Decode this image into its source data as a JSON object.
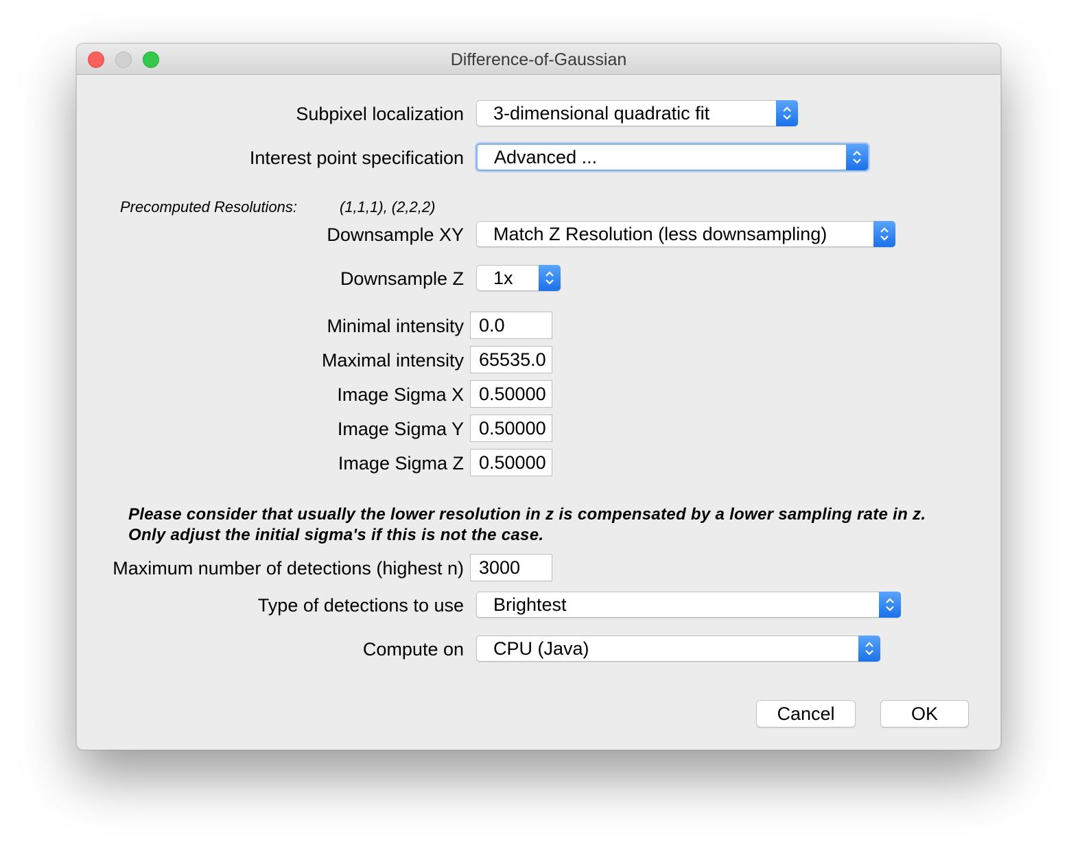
{
  "window": {
    "title": "Difference-of-Gaussian"
  },
  "subpixel": {
    "label": "Subpixel localization",
    "value": "3-dimensional quadratic fit"
  },
  "interest_point": {
    "label": "Interest point specification",
    "value": "Advanced ..."
  },
  "precomputed": {
    "label": "Precomputed Resolutions:",
    "value": "(1,1,1), (2,2,2)"
  },
  "downsample_xy": {
    "label": "Downsample XY",
    "value": "Match Z Resolution (less downsampling)"
  },
  "downsample_z": {
    "label": "Downsample Z",
    "value": "1x"
  },
  "fields": {
    "min_intensity": {
      "label": "Minimal intensity",
      "value": "0.0"
    },
    "max_intensity": {
      "label": "Maximal intensity",
      "value": "65535.0"
    },
    "sigma_x": {
      "label": "Image Sigma X",
      "value": "0.50000"
    },
    "sigma_y": {
      "label": "Image Sigma Y",
      "value": "0.50000"
    },
    "sigma_z": {
      "label": "Image Sigma Z",
      "value": "0.50000"
    }
  },
  "note": {
    "line1": "Please consider that usually the lower resolution in z is compensated by a lower sampling rate in z.",
    "line2": "Only adjust the initial sigma's if this is not the case."
  },
  "max_detections": {
    "label": "Maximum number of detections (highest n)",
    "value": "3000"
  },
  "detection_type": {
    "label": "Type of detections to use",
    "value": "Brightest"
  },
  "compute_on": {
    "label": "Compute on",
    "value": "CPU (Java)"
  },
  "buttons": {
    "cancel": "Cancel",
    "ok": "OK"
  },
  "colors": {
    "accent": "#1a72e8",
    "close": "#fc605c",
    "minimize": "#d1d1d1",
    "maximize": "#34c84a",
    "background": "#ececec"
  },
  "icons": {
    "stepper": "chevron-up-down-icon"
  }
}
